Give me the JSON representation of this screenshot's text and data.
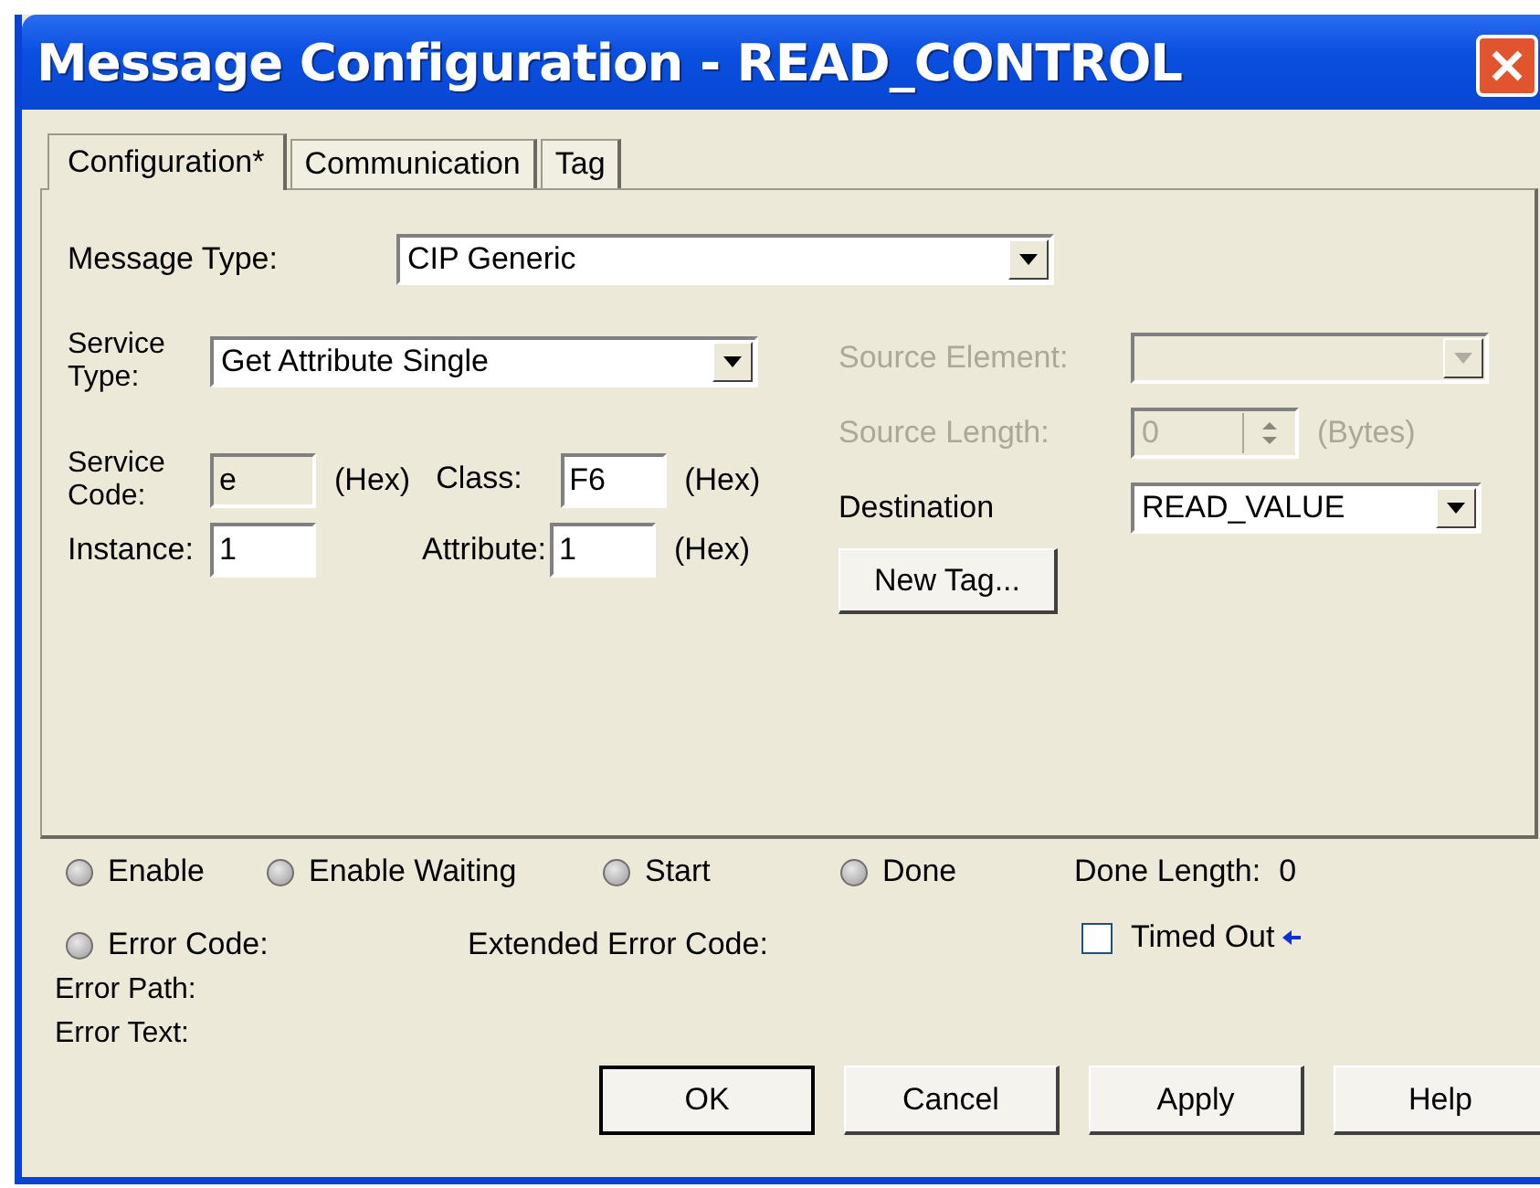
{
  "window": {
    "title": "Message Configuration - READ_CONTROL"
  },
  "tabs": [
    {
      "label": "Configuration*",
      "selected": true
    },
    {
      "label": "Communication",
      "selected": false
    },
    {
      "label": "Tag",
      "selected": false
    }
  ],
  "message_type": {
    "label": "Message Type:",
    "value": "CIP Generic"
  },
  "service_type": {
    "label": "Service Type:",
    "value": "Get Attribute Single"
  },
  "service_code": {
    "label": "Service Code:",
    "value": "e",
    "unit": "(Hex)",
    "disabled": true
  },
  "class": {
    "label": "Class:",
    "value": "F6",
    "unit": "(Hex)"
  },
  "instance": {
    "label": "Instance:",
    "value": "1"
  },
  "attribute": {
    "label": "Attribute:",
    "value": "1",
    "unit": "(Hex)"
  },
  "source_element": {
    "label": "Source Element:",
    "disabled": true
  },
  "source_length": {
    "label": "Source Length:",
    "value": "0",
    "unit": "(Bytes)",
    "disabled": true
  },
  "destination": {
    "label": "Destination",
    "value": "READ_VALUE"
  },
  "new_tag_button": "New Tag...",
  "status": [
    {
      "label": "Enable",
      "on": false
    },
    {
      "label": "Enable Waiting",
      "on": false
    },
    {
      "label": "Start",
      "on": false
    },
    {
      "label": "Done",
      "on": false
    }
  ],
  "done_length": {
    "label": "Done Length:",
    "value": "0"
  },
  "error_code": {
    "label": "Error Code:",
    "on": false
  },
  "extended_error_code": "Extended Error Code:",
  "timed_out": {
    "label": "Timed Out",
    "checked": false
  },
  "error_path": "Error Path:",
  "error_text": "Error Text:",
  "buttons": [
    {
      "label": "OK",
      "default": true
    },
    {
      "label": "Cancel",
      "default": false
    },
    {
      "label": "Apply",
      "default": false
    },
    {
      "label": "Help",
      "default": false
    }
  ]
}
